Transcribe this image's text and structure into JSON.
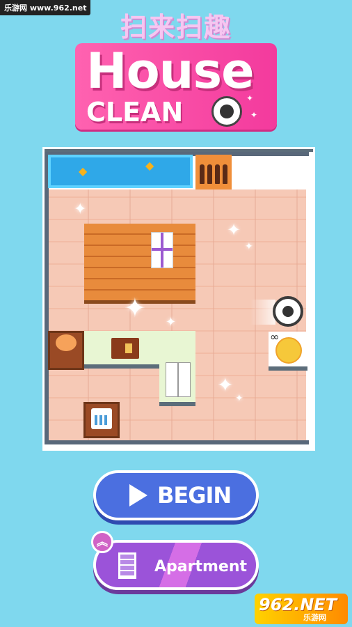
{
  "watermark": {
    "top_text": "乐游网 www.962.net",
    "bottom_main": "962.NET",
    "bottom_sub": "乐游网"
  },
  "title": {
    "chinese": "扫来扫趣",
    "logo_line1": "House",
    "logo_line2": "CLEAN"
  },
  "buttons": {
    "begin_label": "BEGIN",
    "apartment_label": "Apartment"
  },
  "icons": {
    "play": "play-icon",
    "building": "building-icon",
    "double_chevron_up": "double-chevron-up-icon",
    "robot_vacuum": "robot-vacuum-icon"
  },
  "colors": {
    "background": "#7fd8ee",
    "logo_pink": "#f33a9d",
    "begin_blue": "#4b6fe0",
    "apartment_purple": "#9b53d9"
  }
}
